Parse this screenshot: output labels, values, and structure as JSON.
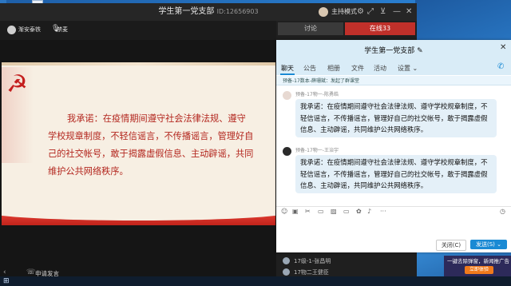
{
  "meeting": {
    "title": "学生第一党支部",
    "id_label": "ID:12656903",
    "host_mode": "主持模式",
    "speaker_name": "渐安泰铁",
    "mute_label": "禁麦",
    "tabs": [
      "讨论",
      "在线33"
    ],
    "slide_text": "我承诺：在疫情期间遵守社会法律法规、遵守学校规章制度，不轻信谣言，不传播谣言，管理好自己的社交帐号，敢于揭露虚假信息、主动辟谣，共同维护公共网络秩序。",
    "apply_speak": "申请发言",
    "members": [
      "17级-1-张昌明",
      "17物二王健臣"
    ]
  },
  "chat": {
    "title": "学生第一党支部",
    "tabs": [
      "聊天",
      "公告",
      "相册",
      "文件",
      "活动",
      "设置"
    ],
    "notice": "预备-17数本-薛珊斌：发起了群课堂",
    "messages": [
      {
        "sender": "预备-17物一-陈勇皓",
        "text": "我承诺：在疫情期间遵守社会法律法规、遵守学校规章制度，不轻信谣言，不传播谣言，管理好自己的社交帐号，敢于揭露虚假信息、主动辟谣，共同维护公共网络秩序。"
      },
      {
        "sender": "预备-17物一-王治宇",
        "text": "我承诺：在疫情期间遵守社会法律法规、遵守学校规章制度，不轻信谣言，不传播谣言，管理好自己的社交帐号，敢于揭露虚假信息、主动辟谣，共同维护公共网络秩序。"
      }
    ],
    "close_label": "关闭(C)",
    "send_label": "发送(S)"
  },
  "ad": {
    "text": "一键去除弹窗，新闻推广告",
    "button": "立即体验"
  },
  "colors": {
    "slide_text": "#b3261e",
    "online_tab": "#c0302a",
    "send_button": "#1a8ad4"
  }
}
